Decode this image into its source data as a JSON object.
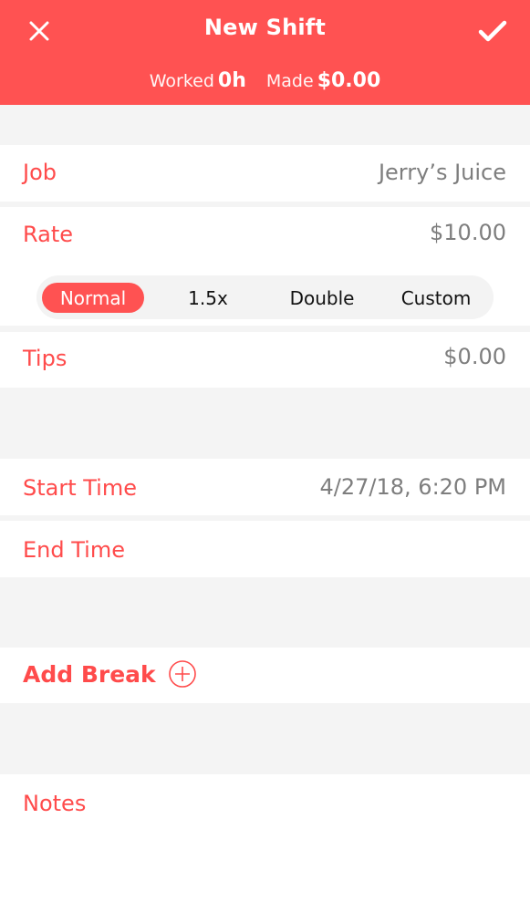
{
  "header": {
    "title": "New Shift",
    "close_icon": "close-icon",
    "save_icon": "checkmark-icon",
    "worked_label": "Worked",
    "worked_value": "0h",
    "made_label": "Made",
    "made_value": "$0.00"
  },
  "fields": {
    "job": {
      "label": "Job",
      "value": "Jerry’s Juice"
    },
    "rate": {
      "label": "Rate",
      "value": "$10.00",
      "options": [
        "Normal",
        "1.5x",
        "Double",
        "Custom"
      ],
      "selected": "Normal"
    },
    "tips": {
      "label": "Tips",
      "value": "$0.00"
    },
    "start_time": {
      "label": "Start Time",
      "value": "4/27/18, 6:20 PM"
    },
    "end_time": {
      "label": "End Time",
      "value": ""
    },
    "add_break": {
      "label": "Add Break",
      "icon": "plus-circle-icon"
    },
    "notes": {
      "label": "Notes",
      "value": ""
    }
  },
  "colors": {
    "accent": "#ff5252",
    "label": "#ff4b4b",
    "value": "#7e7e7e",
    "background": "#f4f4f4"
  }
}
